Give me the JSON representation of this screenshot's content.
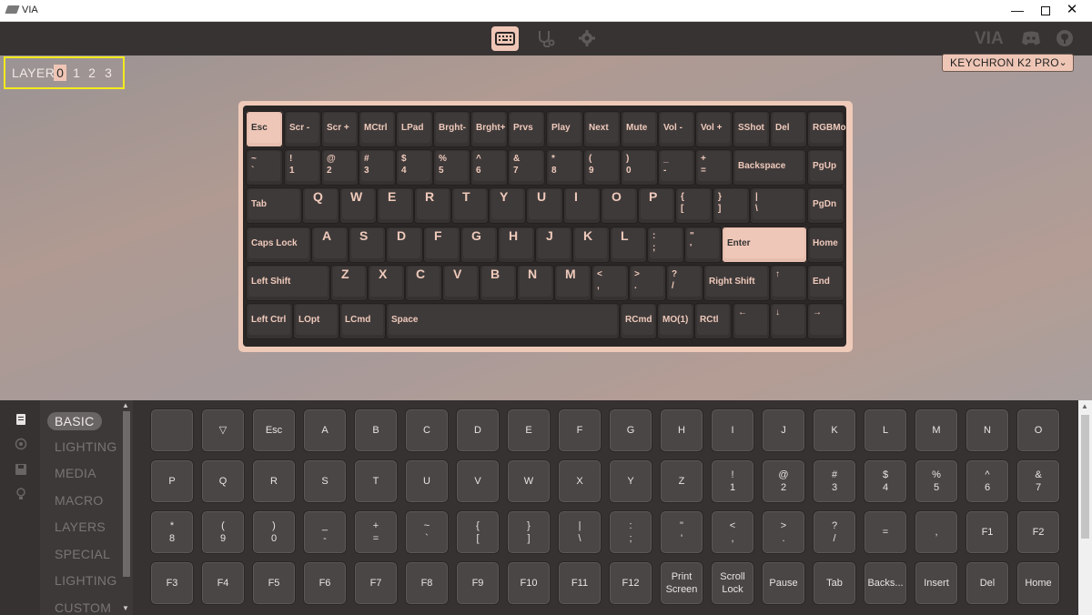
{
  "app": {
    "title": "VIA",
    "brand": "VIA"
  },
  "window": {
    "minimize": "—",
    "close": "✕"
  },
  "nav": {
    "tabs": [
      "keyboard-icon",
      "stethoscope-icon",
      "gear-icon"
    ],
    "active": "keyboard-icon"
  },
  "layer": {
    "label": "LAYER",
    "numbers": [
      "0",
      "1",
      "2",
      "3"
    ],
    "active": 0
  },
  "keyboard_select": {
    "value": "KEYCHRON K2 PRO",
    "chevron": "⌄"
  },
  "keyboard_rows": [
    [
      "Esc",
      "Scr -",
      "Scr +",
      "MCtrl",
      "LPad",
      "Brght-",
      "Brght+",
      "Prvs",
      "Play",
      "Next",
      "Mute",
      "Vol -",
      "Vol +",
      "SShot",
      "Del",
      "RGBMod"
    ],
    [
      "~\n`",
      "!\n1",
      "@\n2",
      "#\n3",
      "$\n4",
      "%\n5",
      "^\n6",
      "&\n7",
      "*\n8",
      "(\n9",
      ")\n0",
      "_\n-",
      "+\n=",
      "Backspace",
      "PgUp"
    ],
    [
      "Tab",
      "Q",
      "W",
      "E",
      "R",
      "T",
      "Y",
      "U",
      "I",
      "O",
      "P",
      "{\n[",
      "}\n]",
      "|\n\\",
      "PgDn"
    ],
    [
      "Caps Lock",
      "A",
      "S",
      "D",
      "F",
      "G",
      "H",
      "J",
      "K",
      "L",
      ":\n;",
      "\"\n'",
      "Enter",
      "Home"
    ],
    [
      "Left Shift",
      "Z",
      "X",
      "C",
      "V",
      "B",
      "N",
      "M",
      "<\n,",
      ">\n.",
      "?\n/",
      "Right Shift",
      "↑",
      "End"
    ],
    [
      "Left Ctrl",
      "LOpt",
      "LCmd",
      "Space",
      "RCmd",
      "MO(1)",
      "RCtl",
      "←",
      "↓",
      "→"
    ]
  ],
  "selected_key": "Esc",
  "categories": [
    "BASIC",
    "LIGHTING",
    "MEDIA",
    "MACRO",
    "LAYERS",
    "SPECIAL",
    "LIGHTING",
    "CUSTOM"
  ],
  "active_category": "BASIC",
  "scroll": {
    "up": "▲",
    "down": "▼"
  },
  "basic_keys": [
    [
      "",
      "▽",
      "Esc",
      "A",
      "B",
      "C",
      "D",
      "E",
      "F",
      "G",
      "H",
      "I",
      "J",
      "K",
      "L",
      "M",
      "N",
      "O"
    ],
    [
      "P",
      "Q",
      "R",
      "S",
      "T",
      "U",
      "V",
      "W",
      "X",
      "Y",
      "Z",
      "!\n1",
      "@\n2",
      "#\n3",
      "$\n4",
      "%\n5",
      "^\n6",
      "&\n7"
    ],
    [
      "*\n8",
      "(\n9",
      ")\n0",
      "_\n-",
      "+\n=",
      "~\n`",
      "{\n[",
      "}\n]",
      "|\n\\",
      ":\n;",
      "\"\n'",
      "<\n,",
      ">\n.",
      "?\n/",
      "=",
      ",",
      "F1",
      "F2"
    ],
    [
      "F3",
      "F4",
      "F5",
      "F6",
      "F7",
      "F8",
      "F9",
      "F10",
      "F11",
      "F12",
      "Print\nScreen",
      "Scroll\nLock",
      "Pause",
      "Tab",
      "Backs...",
      "Insert",
      "Del",
      "Home"
    ]
  ],
  "colors": {
    "accent": "#efc6b6",
    "background": "#363232",
    "highlight": "#f2ea1d"
  }
}
